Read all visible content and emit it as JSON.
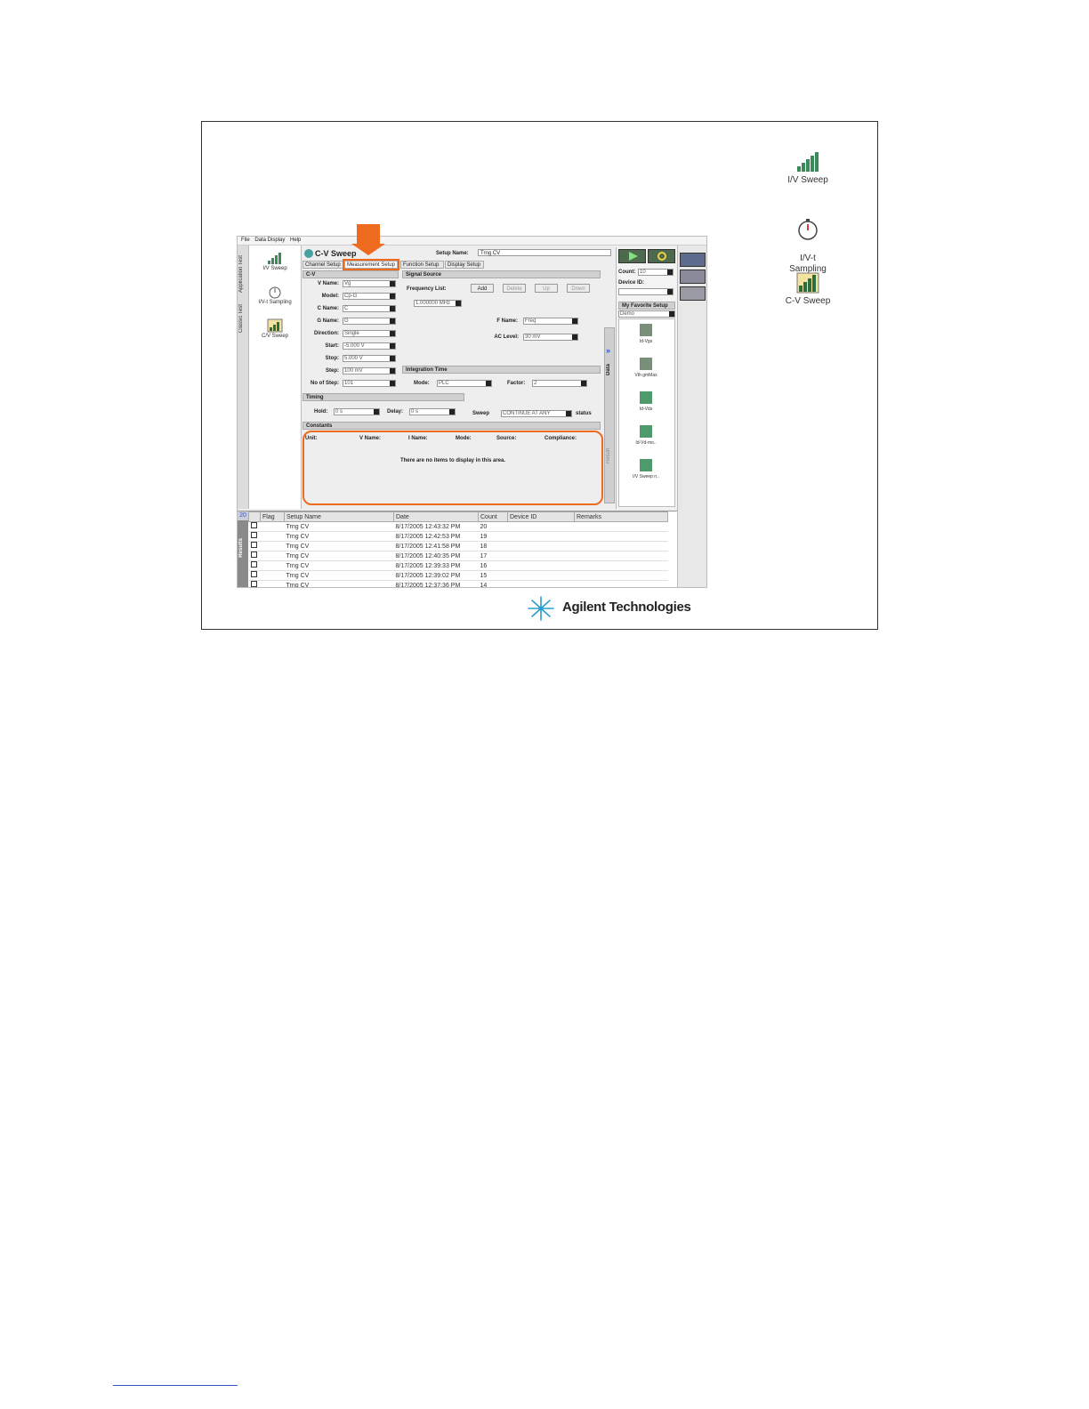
{
  "desktop_icons": [
    {
      "label": "I/V Sweep",
      "icon": "iv-sweep-icon"
    },
    {
      "label": "I/V-t\nSampling",
      "icon": "stopwatch-icon"
    },
    {
      "label": "C-V Sweep",
      "icon": "cv-sweep-icon"
    }
  ],
  "menu": [
    "File",
    "Data Display",
    "Help"
  ],
  "vertical_tabs": [
    "Application Test",
    "Classic Test"
  ],
  "left_panel": [
    {
      "label": "I/V Sweep"
    },
    {
      "label": "I/V-t Sampling"
    },
    {
      "label": "C/V Sweep"
    }
  ],
  "window": {
    "title": "C-V Sweep",
    "setup_name_label": "Setup Name:",
    "setup_name_value": "Trng CV"
  },
  "tabs": [
    "Channel Setup",
    "Measurement Setup",
    "Function Setup",
    "Display Setup"
  ],
  "cv": {
    "header": "C-V",
    "fields": [
      {
        "label": "V Name:",
        "value": "Vg"
      },
      {
        "label": "Model:",
        "value": "Cp-G"
      },
      {
        "label": "C Name:",
        "value": "C"
      },
      {
        "label": "G Name:",
        "value": "G"
      },
      {
        "label": "Direction:",
        "value": "Single"
      },
      {
        "label": "Start:",
        "value": "-5.000 V"
      },
      {
        "label": "Stop:",
        "value": "5.000 V"
      },
      {
        "label": "Step:",
        "value": "100 mV"
      },
      {
        "label": "No of Step:",
        "value": "101"
      }
    ]
  },
  "signal_source": {
    "header": "Signal Source",
    "freq_label": "Frequency List:",
    "buttons": [
      "Add",
      "Delete",
      "Up",
      "Down"
    ],
    "freq_value": "1.000000 MHz",
    "f_name_label": "F Name:",
    "f_name_value": "Freq",
    "ac_level_label": "AC Level:",
    "ac_level_value": "30 mV"
  },
  "integration": {
    "header": "Integration Time",
    "mode_label": "Mode:",
    "mode_value": "PLC",
    "factor_label": "Factor:",
    "factor_value": "2"
  },
  "timing": {
    "header": "Timing",
    "hold_label": "Hold:",
    "hold_value": "0 s",
    "delay_label": "Delay:",
    "delay_value": "0 s",
    "sweep_label": "Sweep",
    "sweep_value": "CONTINUE AT ANY",
    "status_label": "status"
  },
  "constants": {
    "header": "Constants",
    "columns": [
      "Unit:",
      "V Name:",
      "I Name:",
      "Mode:",
      "Source:",
      "Compliance:"
    ],
    "empty_message": "There are no items to display in this area."
  },
  "side": {
    "count_label": "Count:",
    "count_value": "10",
    "device_label": "Device ID:",
    "fav_header": "My Favorite Setup",
    "fav_filter": "Demo",
    "fav_items": [
      "Id-Vgs",
      "Vth gmMax",
      "Id-Vds",
      "Id-Vd-mo..",
      "I/V Sweep n.."
    ],
    "vertical_labels": [
      "Data",
      "Result"
    ],
    "chevron": "»"
  },
  "results": {
    "tab_label": "Results",
    "count_badge": "20",
    "columns": [
      "Flag",
      "Setup Name",
      "Date",
      "Count",
      "Device ID",
      "Remarks"
    ],
    "rows": [
      {
        "name": "Trng CV",
        "date": "8/17/2005 12:43:32 PM",
        "count": "20"
      },
      {
        "name": "Trng CV",
        "date": "8/17/2005 12:42:53 PM",
        "count": "19"
      },
      {
        "name": "Trng CV",
        "date": "8/17/2005 12:41:58 PM",
        "count": "18"
      },
      {
        "name": "Trng CV",
        "date": "8/17/2005 12:40:35 PM",
        "count": "17"
      },
      {
        "name": "Trng CV",
        "date": "8/17/2005 12:39:33 PM",
        "count": "16"
      },
      {
        "name": "Trng CV",
        "date": "8/17/2005 12:39:02 PM",
        "count": "15"
      },
      {
        "name": "Trng CV",
        "date": "8/17/2005 12:37:36 PM",
        "count": "14"
      }
    ]
  },
  "brand": {
    "name": "Agilent Technologies"
  },
  "colors": {
    "highlight": "#ee6a1f",
    "run_button": "#2e9c2e"
  }
}
